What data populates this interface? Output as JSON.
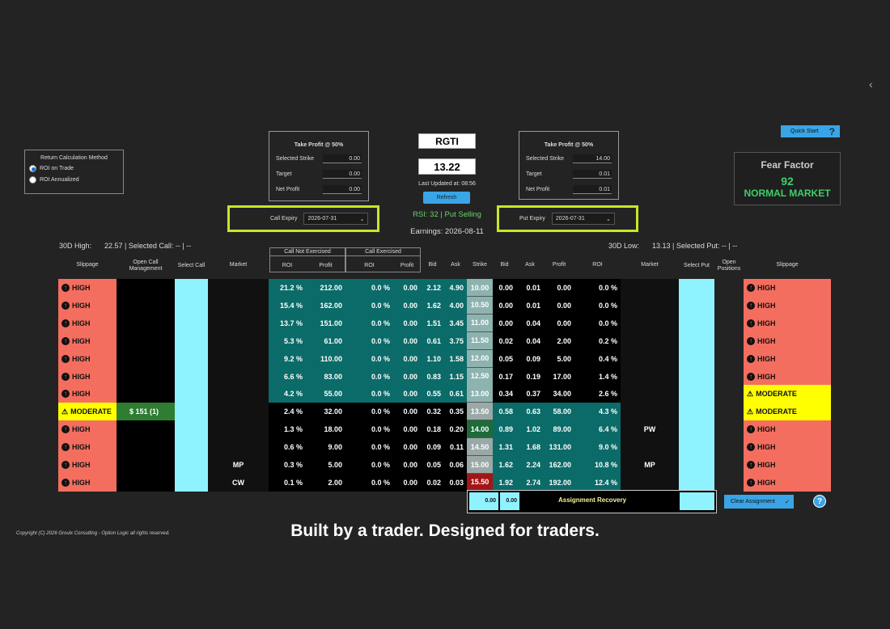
{
  "nav": {
    "back_glyph": "‹"
  },
  "return_calc": {
    "title": "Return Calculation Method",
    "options": [
      "ROI on Trade",
      "ROI Annualized"
    ],
    "selected": 0
  },
  "take_profit_call": {
    "title": "Take Profit @ 50%",
    "rows": [
      {
        "label": "Selected Strike",
        "value": "0.00"
      },
      {
        "label": "Target",
        "value": "0.00"
      },
      {
        "label": "Net Profit",
        "value": "0.00"
      }
    ]
  },
  "take_profit_put": {
    "title": "Take Profit @ 50%",
    "rows": [
      {
        "label": "Selected Strike",
        "value": "14.00"
      },
      {
        "label": "Target",
        "value": "0.01"
      },
      {
        "label": "Net Profit",
        "value": "0.01"
      }
    ]
  },
  "ticker": "RGTI",
  "price": "13.22",
  "last_updated": "Last Updated at: 08:56",
  "refresh_label": "Refresh",
  "rsi": "RSI:  32  |  Put Selling",
  "earnings": "Earnings: 2026-08-11",
  "call_expiry": {
    "label": "Call Expiry",
    "value": "2026-07-31"
  },
  "put_expiry": {
    "label": "Put Expiry",
    "value": "2026-07-31"
  },
  "quick_start": {
    "label": "Quick Start",
    "icon": "?"
  },
  "fear_factor": {
    "title": "Fear Factor",
    "value": "92",
    "status": "NORMAL MARKET"
  },
  "high_info": {
    "label": "30D High:",
    "value": "22.57 | Selected Call: -- | --"
  },
  "low_info": {
    "label": "30D Low:",
    "value": "13.13 | Selected Put: -- | --"
  },
  "headers": {
    "slippage": "Slippage",
    "open_call_mgmt": "Open Call Management",
    "select_call": "Select Call",
    "market": "Market",
    "call_not_exercised": "Call Not Exercised",
    "call_exercised": "Call Exercised",
    "roi": "ROI",
    "profit": "Profit",
    "bid": "Bid",
    "ask": "Ask",
    "strike": "Strike",
    "select_put": "Select Put",
    "open_positions": "Open Positions"
  },
  "rows": [
    {
      "cslip": "HIGH",
      "ocm": "",
      "cmkt": "",
      "cne_roi": "21.2 %",
      "cne_profit": "212.00",
      "ce_roi": "0.0 %",
      "ce_profit": "0.00",
      "cbid": "2.12",
      "cask": "4.90",
      "strike": "10.00",
      "pbid": "0.00",
      "pask": "0.01",
      "pprofit": "0.00",
      "proi": "0.0 %",
      "pmkt": "",
      "pslip": "HIGH",
      "itm": true
    },
    {
      "cslip": "HIGH",
      "ocm": "",
      "cmkt": "",
      "cne_roi": "15.4 %",
      "cne_profit": "162.00",
      "ce_roi": "0.0 %",
      "ce_profit": "0.00",
      "cbid": "1.62",
      "cask": "4.00",
      "strike": "10.50",
      "pbid": "0.00",
      "pask": "0.01",
      "pprofit": "0.00",
      "proi": "0.0 %",
      "pmkt": "",
      "pslip": "HIGH",
      "itm": true
    },
    {
      "cslip": "HIGH",
      "ocm": "",
      "cmkt": "",
      "cne_roi": "13.7 %",
      "cne_profit": "151.00",
      "ce_roi": "0.0 %",
      "ce_profit": "0.00",
      "cbid": "1.51",
      "cask": "3.45",
      "strike": "11.00",
      "pbid": "0.00",
      "pask": "0.04",
      "pprofit": "0.00",
      "proi": "0.0 %",
      "pmkt": "",
      "pslip": "HIGH",
      "itm": true
    },
    {
      "cslip": "HIGH",
      "ocm": "",
      "cmkt": "",
      "cne_roi": "5.3 %",
      "cne_profit": "61.00",
      "ce_roi": "0.0 %",
      "ce_profit": "0.00",
      "cbid": "0.61",
      "cask": "3.75",
      "strike": "11.50",
      "pbid": "0.02",
      "pask": "0.04",
      "pprofit": "2.00",
      "proi": "0.2 %",
      "pmkt": "",
      "pslip": "HIGH",
      "itm": true
    },
    {
      "cslip": "HIGH",
      "ocm": "",
      "cmkt": "",
      "cne_roi": "9.2 %",
      "cne_profit": "110.00",
      "ce_roi": "0.0 %",
      "ce_profit": "0.00",
      "cbid": "1.10",
      "cask": "1.58",
      "strike": "12.00",
      "pbid": "0.05",
      "pask": "0.09",
      "pprofit": "5.00",
      "proi": "0.4 %",
      "pmkt": "",
      "pslip": "HIGH",
      "itm": true
    },
    {
      "cslip": "HIGH",
      "ocm": "",
      "cmkt": "",
      "cne_roi": "6.6 %",
      "cne_profit": "83.00",
      "ce_roi": "0.0 %",
      "ce_profit": "0.00",
      "cbid": "0.83",
      "cask": "1.15",
      "strike": "12.50",
      "pbid": "0.17",
      "pask": "0.19",
      "pprofit": "17.00",
      "proi": "1.4 %",
      "pmkt": "",
      "pslip": "HIGH",
      "itm": true
    },
    {
      "cslip": "HIGH",
      "ocm": "",
      "cmkt": "",
      "cne_roi": "4.2 %",
      "cne_profit": "55.00",
      "ce_roi": "0.0 %",
      "ce_profit": "0.00",
      "cbid": "0.55",
      "cask": "0.61",
      "strike": "13.00",
      "pbid": "0.34",
      "pask": "0.37",
      "pprofit": "34.00",
      "proi": "2.6 %",
      "pmkt": "",
      "pslip": "MODERATE",
      "itm": true
    },
    {
      "cslip": "MODERATE",
      "ocm": "$      151 (1)",
      "cmkt": "",
      "cne_roi": "2.4 %",
      "cne_profit": "32.00",
      "ce_roi": "0.0 %",
      "ce_profit": "0.00",
      "cbid": "0.32",
      "cask": "0.35",
      "strike": "13.50",
      "pbid": "0.58",
      "pask": "0.63",
      "pprofit": "58.00",
      "proi": "4.3 %",
      "pmkt": "",
      "pslip": "MODERATE",
      "itm": false
    },
    {
      "cslip": "HIGH",
      "ocm": "",
      "cmkt": "",
      "cne_roi": "1.3 %",
      "cne_profit": "18.00",
      "ce_roi": "0.0 %",
      "ce_profit": "0.00",
      "cbid": "0.18",
      "cask": "0.20",
      "strike": "14.00",
      "pbid": "0.89",
      "pask": "1.02",
      "pprofit": "89.00",
      "proi": "6.4 %",
      "pmkt": "PW",
      "pslip": "HIGH",
      "itm": false
    },
    {
      "cslip": "HIGH",
      "ocm": "",
      "cmkt": "",
      "cne_roi": "0.6 %",
      "cne_profit": "9.00",
      "ce_roi": "0.0 %",
      "ce_profit": "0.00",
      "cbid": "0.09",
      "cask": "0.11",
      "strike": "14.50",
      "pbid": "1.31",
      "pask": "1.68",
      "pprofit": "131.00",
      "proi": "9.0 %",
      "pmkt": "",
      "pslip": "HIGH",
      "itm": false
    },
    {
      "cslip": "HIGH",
      "ocm": "",
      "cmkt": "MP",
      "cne_roi": "0.3 %",
      "cne_profit": "5.00",
      "ce_roi": "0.0 %",
      "ce_profit": "0.00",
      "cbid": "0.05",
      "cask": "0.06",
      "strike": "15.00",
      "pbid": "1.62",
      "pask": "2.24",
      "pprofit": "162.00",
      "proi": "10.8 %",
      "pmkt": "MP",
      "pslip": "HIGH",
      "itm": false
    },
    {
      "cslip": "HIGH",
      "ocm": "",
      "cmkt": "CW",
      "cne_roi": "0.1 %",
      "cne_profit": "2.00",
      "ce_roi": "0.0 %",
      "ce_profit": "0.00",
      "cbid": "0.02",
      "cask": "0.03",
      "strike": "15.50",
      "pbid": "1.92",
      "pask": "2.74",
      "pprofit": "192.00",
      "proi": "12.4 %",
      "pmkt": "",
      "pslip": "HIGH",
      "itm": false
    }
  ],
  "assignment_recovery": {
    "label": "Assignment Recovery",
    "v1": "0.00",
    "v2": "0.00"
  },
  "clear_assignment": {
    "label": "Clear Assignment",
    "icon": "✓"
  },
  "help_icon": "?",
  "copyright": "Copyright (C) 2026 Groulx Consulting - Option Logic all rights reserved.",
  "tagline": "Built by a trader. Designed for traders.",
  "colors": {
    "high": "#f46e5f",
    "moderate": "#ffff00",
    "teal": "#0b6b68",
    "cyan": "#8ff2ff",
    "selected_strike_green": "#1e6b3a",
    "last_strike_red": "#a31616",
    "strike_itm": "#8db3b0"
  }
}
